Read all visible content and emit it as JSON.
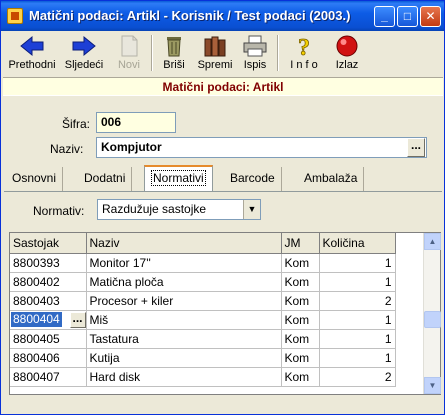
{
  "window": {
    "title": "Matični podaci: Artikl - Korisnik / Test podaci (2003.)",
    "minimize": "_",
    "maximize": "□",
    "close": "✕"
  },
  "toolbar": {
    "prethodni": "Prethodni",
    "sljedeci": "Sljedeći",
    "novi": "Novi",
    "brisi": "Briši",
    "spremi": "Spremi",
    "ispis": "Ispis",
    "info": "I n f o",
    "izlaz": "Izlaz"
  },
  "heading": "Matični podaci: Artikl",
  "form": {
    "sifra_label": "Šifra:",
    "sifra_value": "006",
    "naziv_label": "Naziv:",
    "naziv_value": "Kompjutor",
    "ellipsis": "..."
  },
  "tabs": [
    "Osnovni",
    "Dodatni",
    "Normativi",
    "Barcode",
    "Ambalaža"
  ],
  "active_tab": "Normativi",
  "normativ": {
    "label": "Normativ:",
    "selected": "Razdužuje sastojke"
  },
  "grid": {
    "columns": [
      "Sastojak",
      "Naziv",
      "JM",
      "Količina"
    ],
    "rows": [
      {
        "sastojak": "8800393",
        "naziv": "Monitor 17''",
        "jm": "Kom",
        "kolicina": "1"
      },
      {
        "sastojak": "8800402",
        "naziv": "Matična ploča",
        "jm": "Kom",
        "kolicina": "1"
      },
      {
        "sastojak": "8800403",
        "naziv": "Procesor + kiler",
        "jm": "Kom",
        "kolicina": "2"
      },
      {
        "sastojak": "8800404",
        "naziv": "Miš",
        "jm": "Kom",
        "kolicina": "1"
      },
      {
        "sastojak": "8800405",
        "naziv": "Tastatura",
        "jm": "Kom",
        "kolicina": "1"
      },
      {
        "sastojak": "8800406",
        "naziv": "Kutija",
        "jm": "Kom",
        "kolicina": "1"
      },
      {
        "sastojak": "8800407",
        "naziv": "Hard disk",
        "jm": "Kom",
        "kolicina": "2"
      }
    ],
    "selected_row": 3
  },
  "colors": {
    "title_blue": "#0a5bd6",
    "heading_text": "#800000",
    "heading_bg": "#ffffe1",
    "selection": "#316ac5"
  }
}
